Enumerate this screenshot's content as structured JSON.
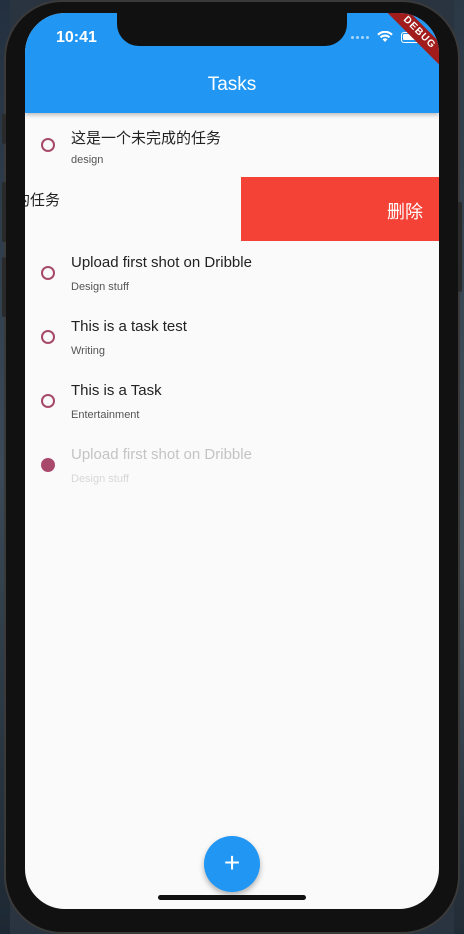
{
  "status_bar": {
    "time": "10:41",
    "debug_banner": "DEBUG"
  },
  "appbar": {
    "title": "Tasks"
  },
  "tasks": [
    {
      "title": "这是一个未完成的任务",
      "subtitle": "design",
      "completed": false
    },
    {
      "title": "Upload first shot on Dribble",
      "subtitle": "Design stuff",
      "completed": false
    },
    {
      "title": "This is a task test",
      "subtitle": "Writing",
      "completed": false
    },
    {
      "title": "This is a Task",
      "subtitle": "Entertainment",
      "completed": false
    },
    {
      "title": "Upload first shot on Dribble",
      "subtitle": "Design stuff",
      "completed": true
    }
  ],
  "swipe": {
    "partial_text": "的任务",
    "delete_label": "删除"
  },
  "fab": {
    "icon": "plus-icon",
    "label": "+"
  },
  "colors": {
    "primary": "#2196f3",
    "accent": "#a8486a",
    "delete": "#f44336"
  }
}
